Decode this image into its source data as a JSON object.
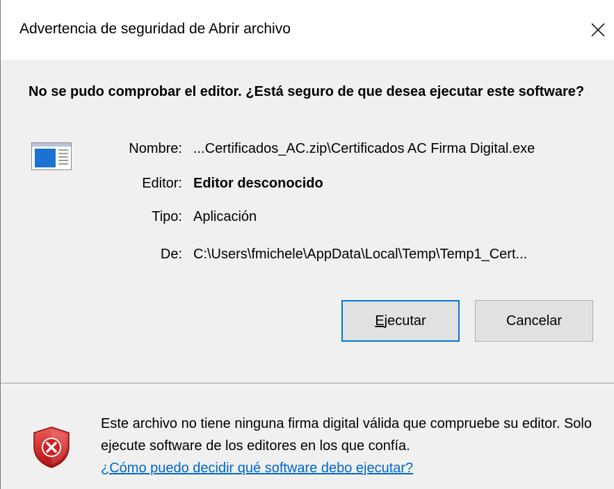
{
  "window": {
    "title": "Advertencia de seguridad de Abrir archivo"
  },
  "headline": "No se pudo comprobar el editor. ¿Está seguro de que desea ejecutar este software?",
  "details": {
    "name_label": "Nombre:",
    "name_value": "...Certificados_AC.zip\\Certificados AC Firma Digital.exe",
    "publisher_label": "Editor:",
    "publisher_value": "Editor desconocido",
    "type_label": "Tipo:",
    "type_value": "Aplicación",
    "from_label": "De:",
    "from_value": "C:\\Users\\fmichele\\AppData\\Local\\Temp\\Temp1_Cert..."
  },
  "buttons": {
    "run_mnemonic": "E",
    "run_rest": "jecutar",
    "cancel_label": "Cancelar"
  },
  "footer": {
    "warning_text": "Este archivo no tiene ninguna firma digital válida que compruebe su editor. Solo ejecute software de los editores en los que confía.",
    "help_link": "¿Cómo puedo decidir qué software debo ejecutar?"
  },
  "icons": {
    "close": "close-icon",
    "application": "application-window-icon",
    "warning": "red-shield-x-icon"
  },
  "colors": {
    "accent_border": "#0078d7",
    "link": "#0066cc",
    "shield_red": "#d42020"
  }
}
